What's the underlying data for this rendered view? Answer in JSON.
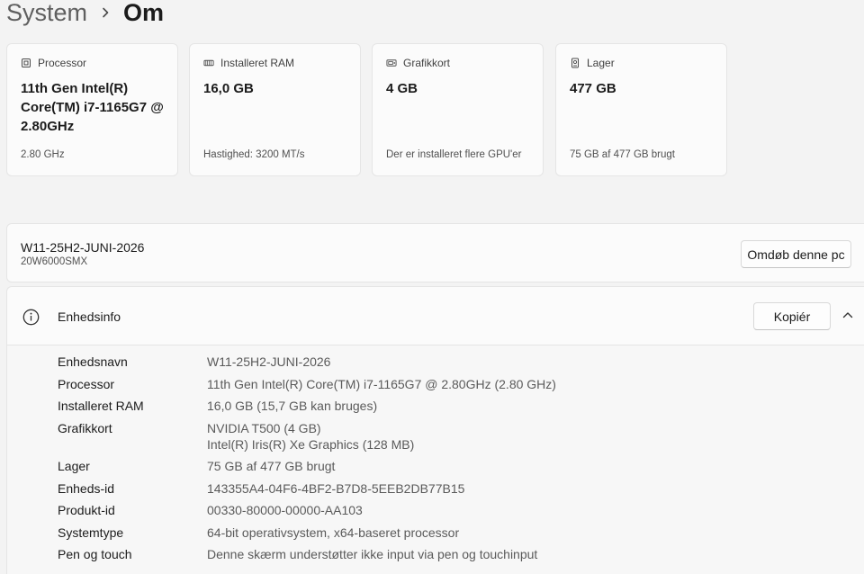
{
  "breadcrumb": {
    "parent": "System",
    "current": "Om"
  },
  "cards": [
    {
      "label": "Processor",
      "icon": "cpu-icon",
      "value": "11th Gen Intel(R) Core(TM) i7-1165G7 @ 2.80GHz",
      "sub": "2.80 GHz"
    },
    {
      "label": "Installeret RAM",
      "icon": "ram-icon",
      "value": "16,0 GB",
      "sub": "Hastighed: 3200 MT/s"
    },
    {
      "label": "Grafikkort",
      "icon": "gpu-icon",
      "value": "4 GB",
      "sub": "Der er installeret flere GPU'er"
    },
    {
      "label": "Lager",
      "icon": "storage-icon",
      "value": "477 GB",
      "sub": "75 GB af 477 GB brugt"
    }
  ],
  "device": {
    "name": "W11-25H2-JUNI-2026",
    "model": "20W6000SMX",
    "rename_label": "Omdøb denne pc"
  },
  "info": {
    "title": "Enhedsinfo",
    "copy_label": "Kopiér",
    "rows": [
      {
        "key": "Enhedsnavn",
        "value": "W11-25H2-JUNI-2026"
      },
      {
        "key": "Processor",
        "value": "11th Gen Intel(R) Core(TM) i7-1165G7 @ 2.80GHz (2.80 GHz)"
      },
      {
        "key": "Installeret RAM",
        "value": "16,0 GB (15,7 GB kan bruges)"
      },
      {
        "key": "Grafikkort",
        "value": "NVIDIA T500 (4 GB)",
        "value2": "Intel(R) Iris(R) Xe Graphics (128 MB)"
      },
      {
        "key": "Lager",
        "value": "75 GB af 477 GB brugt"
      },
      {
        "key": "Enheds-id",
        "value": "143355A4-04F6-4BF2-B7D8-5EEB2DB77B15"
      },
      {
        "key": "Produkt-id",
        "value": "00330-80000-00000-AA103"
      },
      {
        "key": "Systemtype",
        "value": "64-bit operativsystem, x64-baseret processor"
      },
      {
        "key": "Pen og touch",
        "value": "Denne skærm understøtter ikke input via pen og touchinput"
      }
    ]
  },
  "colors": {
    "background": "#f3f3f3",
    "card": "#fbfbfb",
    "border": "#e5e5e5",
    "text": "#1b1b1b",
    "secondary_text": "#5a5a5a"
  }
}
